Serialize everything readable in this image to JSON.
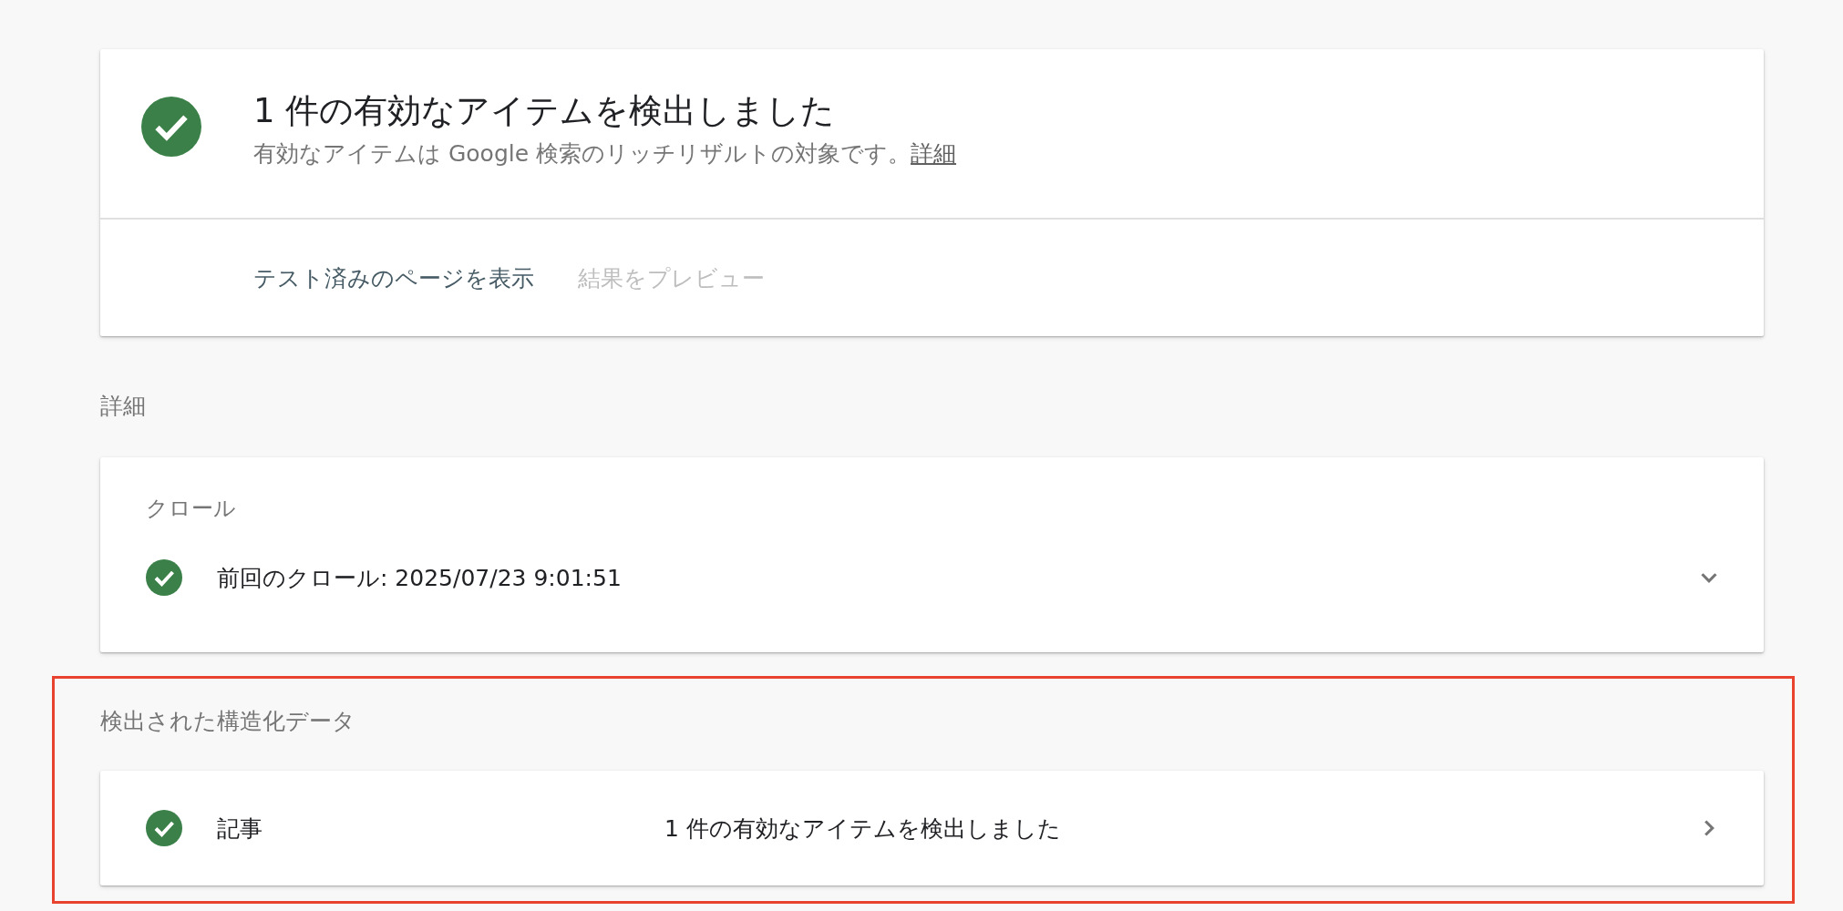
{
  "summary": {
    "valid": true,
    "title": "1 件の有効なアイテムを検出しました",
    "description": "有効なアイテムは Google 検索のリッチリザルトの対象です。",
    "link": "詳細",
    "actions": [
      {
        "label": "テスト済みのページを表示",
        "disabled": false
      },
      {
        "label": "結果をプレビュー",
        "disabled": true
      }
    ]
  },
  "details": {
    "heading": "詳細",
    "crawl": {
      "title": "クロール",
      "valid": true,
      "text": "前回のクロール: 2025/07/23 9:01:51",
      "expanded": false
    }
  },
  "structured_data": {
    "highlighted": true,
    "heading": "検出された構造化データ",
    "items": [
      {
        "valid": true,
        "name": "記事",
        "result": "1 件の有効なアイテムを検出しました"
      }
    ]
  }
}
